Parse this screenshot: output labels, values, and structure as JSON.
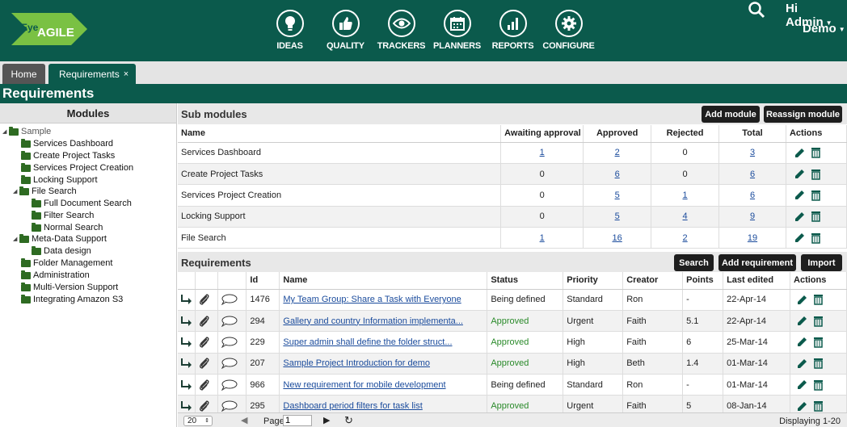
{
  "brand": {
    "logo_text_1": "Eye",
    "logo_text_2": "AGILE"
  },
  "nav": [
    {
      "label": "IDEAS",
      "icon": "bulb-icon"
    },
    {
      "label": "QUALITY",
      "icon": "thumbs-up-icon"
    },
    {
      "label": "TRACKERS",
      "icon": "eye-icon"
    },
    {
      "label": "PLANNERS",
      "icon": "calendar-icon"
    },
    {
      "label": "REPORTS",
      "icon": "bar-chart-icon"
    },
    {
      "label": "CONFIGURE",
      "icon": "gear-icon"
    }
  ],
  "header": {
    "user": "Hi Admin",
    "project": "Demo"
  },
  "tabs": {
    "home": "Home",
    "requirements": "Requirements",
    "close": "×"
  },
  "page": {
    "title": "Requirements"
  },
  "modules": {
    "title": "Modules",
    "root": "Sample",
    "items": [
      "Services Dashboard",
      "Create Project Tasks",
      "Services Project Creation",
      "Locking Support",
      "File Search",
      "Full Document Search",
      "Filter Search",
      "Normal Search",
      "Meta-Data Support",
      "Data design",
      "Folder Management",
      "Administration",
      "Multi-Version Support",
      "Integrating Amazon S3"
    ]
  },
  "submodules": {
    "title": "Sub modules",
    "add_button": "Add module",
    "reassign_button": "Reassign module",
    "columns": [
      "Name",
      "Awaiting approval",
      "Approved",
      "Rejected",
      "Total",
      "Actions"
    ],
    "rows": [
      [
        "Services Dashboard",
        "1",
        "2",
        "0",
        "3"
      ],
      [
        "Create Project Tasks",
        "0",
        "6",
        "0",
        "6"
      ],
      [
        "Services Project Creation",
        "0",
        "5",
        "1",
        "6"
      ],
      [
        "Locking Support",
        "0",
        "5",
        "4",
        "9"
      ],
      [
        "File Search",
        "1",
        "16",
        "2",
        "19"
      ]
    ]
  },
  "requirements": {
    "title": "Requirements",
    "search_button": "Search",
    "add_button": "Add requirement",
    "import_button": "Import",
    "columns": [
      "Id",
      "Name",
      "Status",
      "Priority",
      "Creator",
      "Points",
      "Last edited",
      "Actions"
    ],
    "rows": [
      [
        "1476",
        "My Team Group: Share a Task with Everyone",
        "Being defined",
        "Standard",
        "Ron",
        "-",
        "22-Apr-14"
      ],
      [
        "294",
        "Gallery and country Information implementa...",
        "Approved",
        "Urgent",
        "Faith",
        "5.1",
        "22-Apr-14"
      ],
      [
        "229",
        "Super admin shall define the folder struct...",
        "Approved",
        "High",
        "Faith",
        "6",
        "25-Mar-14"
      ],
      [
        "207",
        "Sample Project Introduction for demo",
        "Approved",
        "High",
        "Beth",
        "1.4",
        "01-Mar-14"
      ],
      [
        "966",
        "New requirement for mobile development",
        "Being defined",
        "Standard",
        "Ron",
        "-",
        "01-Mar-14"
      ],
      [
        "295",
        "Dashboard period filters for task list",
        "Approved",
        "Urgent",
        "Faith",
        "5",
        "08-Jan-14"
      ]
    ]
  },
  "footer": {
    "page_size": "20",
    "page_label": "Page",
    "page_value": "1",
    "displaying": "Displaying 1-20"
  },
  "colors": {
    "brand": "#0b5a4c",
    "logo": "#7ac143",
    "link": "#1a4b9c",
    "approved": "#2a8a2a"
  }
}
